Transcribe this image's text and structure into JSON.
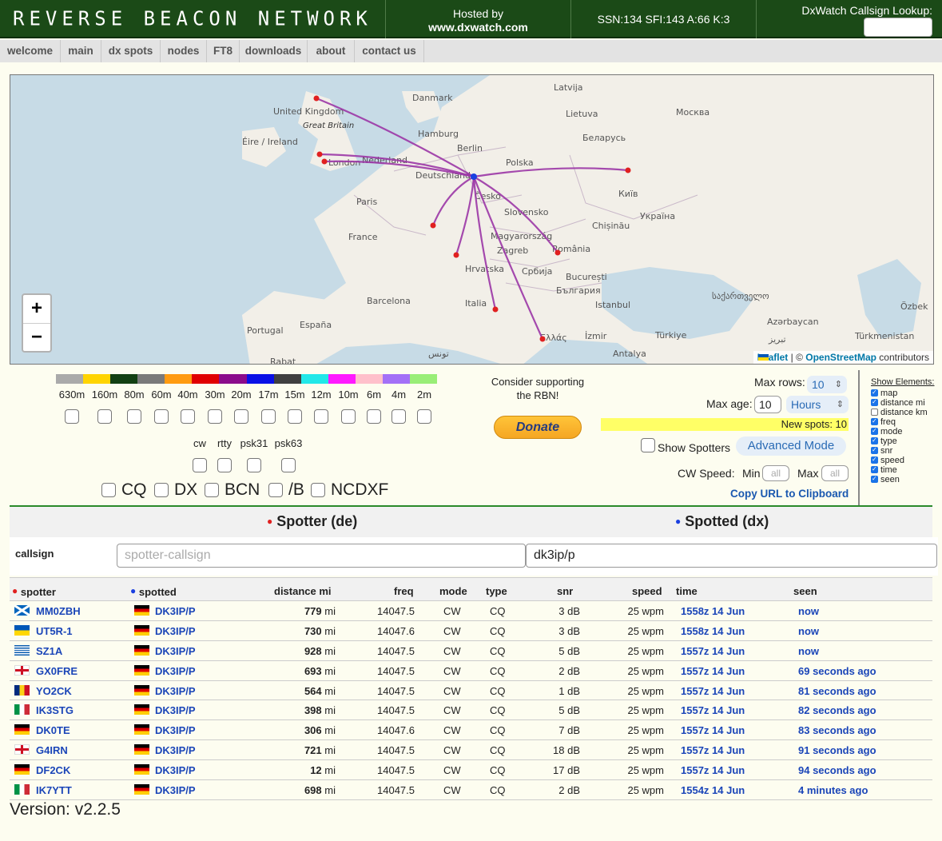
{
  "header": {
    "logo": "REVERSE BEACON NETWORK",
    "hosted_line1": "Hosted by",
    "hosted_line2": "www.dxwatch.com",
    "solar": "SSN:134 SFI:143 A:66 K:3",
    "lookup_label": "DxWatch Callsign Lookup:"
  },
  "nav": [
    "welcome",
    "main",
    "dx spots",
    "nodes",
    "FT8",
    "downloads",
    "about",
    "contact us"
  ],
  "map": {
    "labels": [
      "Latvija",
      "Danmark",
      "Lietuva",
      "Москва",
      "United Kingdom",
      "Great Britain",
      "Hamburg",
      "Беларусь",
      "Éire / Ireland",
      "Berlin",
      "London",
      "Nederland",
      "Polska",
      "Deutschland",
      "Київ",
      "Česko",
      "Paris",
      "Slovensko",
      "Україна",
      "Chișinău",
      "France",
      "Magyarország",
      "Zagreb",
      "România",
      "Hrvatska",
      "Србија",
      "București",
      "България",
      "Barcelona",
      "Italia",
      "Istanbul",
      "საქართველო",
      "Portugal",
      "España",
      "Azərbaycan",
      "Özbek",
      "Ελλάς",
      "İzmir",
      "Türkiye",
      "Türkmenistan",
      "Antalya",
      "Rabat",
      "تونس",
      "تبریز"
    ],
    "zoom_in": "+",
    "zoom_out": "−",
    "attribution_leaflet": "Leaflet",
    "attribution_sep": "| ©",
    "attribution_osm": "OpenStreetMap",
    "attribution_rest": "contributors"
  },
  "bands": {
    "labels": [
      "630m",
      "160m",
      "80m",
      "60m",
      "40m",
      "30m",
      "20m",
      "17m",
      "15m",
      "12m",
      "10m",
      "6m",
      "4m",
      "2m"
    ],
    "colors": [
      "#aaaaaa",
      "#ffd400",
      "#124012",
      "#7a7a7a",
      "#ff9b10",
      "#e00000",
      "#8b0c8b",
      "#0a11e6",
      "#404040",
      "#22e8e8",
      "#ff1aff",
      "#ffc0cb",
      "#a370f7",
      "#99ee77"
    ]
  },
  "modes": [
    "cw",
    "rtty",
    "psk31",
    "psk63"
  ],
  "filters": [
    "CQ",
    "DX",
    "BCN",
    "/B",
    "NCDXF"
  ],
  "donate": {
    "text": "Consider supporting the RBN!",
    "button": "Donate"
  },
  "controls": {
    "max_rows_label": "Max rows:",
    "max_rows_value": "10",
    "max_age_label": "Max age:",
    "max_age_value": "10",
    "max_age_unit": "Hours",
    "new_spots": "New spots: 10",
    "show_spotters": "Show Spotters",
    "advanced_mode": "Advanced Mode",
    "cw_speed_label": "CW Speed:",
    "min_label": "Min",
    "max_label": "Max",
    "min_placeholder": "all",
    "max_placeholder": "all",
    "copy_url": "Copy URL to Clipboard"
  },
  "show_elements": {
    "title": "Show Elements:",
    "items": [
      {
        "label": "map",
        "checked": true
      },
      {
        "label": "distance mi",
        "checked": true
      },
      {
        "label": "distance km",
        "checked": false
      },
      {
        "label": "freq",
        "checked": true
      },
      {
        "label": "mode",
        "checked": true
      },
      {
        "label": "type",
        "checked": true
      },
      {
        "label": "snr",
        "checked": true
      },
      {
        "label": "speed",
        "checked": true
      },
      {
        "label": "time",
        "checked": true
      },
      {
        "label": "seen",
        "checked": true
      }
    ]
  },
  "spots_header": {
    "spotter": "Spotter (de)",
    "spotted": "Spotted (dx)",
    "callsign_label": "callsign",
    "spotter_placeholder": "spotter-callsign",
    "spotted_value": "dk3ip/p"
  },
  "table": {
    "headers": {
      "spotter": "spotter",
      "spotted": "spotted",
      "distance": "distance mi",
      "freq": "freq",
      "mode": "mode",
      "type": "type",
      "snr": "snr",
      "speed": "speed",
      "time": "time",
      "seen": "seen"
    },
    "unit": "mi",
    "rows": [
      {
        "flag": "sc",
        "spotter": "MM0ZBH",
        "spotted": "DK3IP/P",
        "distance": "779",
        "freq": "14047.5",
        "mode": "CW",
        "type": "CQ",
        "snr": "3 dB",
        "speed": "25 wpm",
        "time": "1558z 14 Jun",
        "seen": "now"
      },
      {
        "flag": "ua",
        "spotter": "UT5R-1",
        "spotted": "DK3IP/P",
        "distance": "730",
        "freq": "14047.6",
        "mode": "CW",
        "type": "CQ",
        "snr": "3 dB",
        "speed": "25 wpm",
        "time": "1558z 14 Jun",
        "seen": "now"
      },
      {
        "flag": "gr",
        "spotter": "SZ1A",
        "spotted": "DK3IP/P",
        "distance": "928",
        "freq": "14047.5",
        "mode": "CW",
        "type": "CQ",
        "snr": "5 dB",
        "speed": "25 wpm",
        "time": "1557z 14 Jun",
        "seen": "now"
      },
      {
        "flag": "en",
        "spotter": "GX0FRE",
        "spotted": "DK3IP/P",
        "distance": "693",
        "freq": "14047.5",
        "mode": "CW",
        "type": "CQ",
        "snr": "2 dB",
        "speed": "25 wpm",
        "time": "1557z 14 Jun",
        "seen": "69 seconds ago"
      },
      {
        "flag": "ro",
        "spotter": "YO2CK",
        "spotted": "DK3IP/P",
        "distance": "564",
        "freq": "14047.5",
        "mode": "CW",
        "type": "CQ",
        "snr": "1 dB",
        "speed": "25 wpm",
        "time": "1557z 14 Jun",
        "seen": "81 seconds ago"
      },
      {
        "flag": "it",
        "spotter": "IK3STG",
        "spotted": "DK3IP/P",
        "distance": "398",
        "freq": "14047.5",
        "mode": "CW",
        "type": "CQ",
        "snr": "5 dB",
        "speed": "25 wpm",
        "time": "1557z 14 Jun",
        "seen": "82 seconds ago"
      },
      {
        "flag": "de",
        "spotter": "DK0TE",
        "spotted": "DK3IP/P",
        "distance": "306",
        "freq": "14047.6",
        "mode": "CW",
        "type": "CQ",
        "snr": "7 dB",
        "speed": "25 wpm",
        "time": "1557z 14 Jun",
        "seen": "83 seconds ago"
      },
      {
        "flag": "en",
        "spotter": "G4IRN",
        "spotted": "DK3IP/P",
        "distance": "721",
        "freq": "14047.5",
        "mode": "CW",
        "type": "CQ",
        "snr": "18 dB",
        "speed": "25 wpm",
        "time": "1557z 14 Jun",
        "seen": "91 seconds ago"
      },
      {
        "flag": "de",
        "spotter": "DF2CK",
        "spotted": "DK3IP/P",
        "distance": "12",
        "freq": "14047.5",
        "mode": "CW",
        "type": "CQ",
        "snr": "17 dB",
        "speed": "25 wpm",
        "time": "1557z 14 Jun",
        "seen": "94 seconds ago"
      },
      {
        "flag": "it",
        "spotter": "IK7YTT",
        "spotted": "DK3IP/P",
        "distance": "698",
        "freq": "14047.5",
        "mode": "CW",
        "type": "CQ",
        "snr": "2 dB",
        "speed": "25 wpm",
        "time": "1554z 14 Jun",
        "seen": "4 minutes ago"
      }
    ]
  },
  "version": "Version: v2.2.5"
}
